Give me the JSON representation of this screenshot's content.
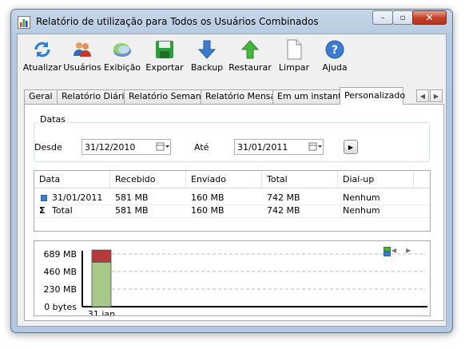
{
  "window": {
    "title": "Relatório de utilização para Todos os Usuários Combinados",
    "controls": {
      "minimize": "–",
      "maximize": "▫",
      "close": "✕"
    }
  },
  "toolbar": {
    "buttons": [
      {
        "label": "Atualizar",
        "icon": "refresh-icon"
      },
      {
        "label": "Usuários",
        "icon": "users-icon"
      },
      {
        "label": "Exibição",
        "icon": "view-icon"
      },
      {
        "label": "Exportar",
        "icon": "save-icon"
      },
      {
        "label": "Backup",
        "icon": "arrow-down-icon"
      },
      {
        "label": "Restaurar",
        "icon": "arrow-up-icon"
      },
      {
        "label": "Limpar",
        "icon": "document-icon"
      },
      {
        "label": "Ajuda",
        "icon": "help-icon"
      }
    ]
  },
  "tabs": [
    {
      "label": "Geral",
      "active": false
    },
    {
      "label": "Relatório Diário",
      "active": false
    },
    {
      "label": "Relatório Semanal",
      "active": false
    },
    {
      "label": "Relatório Mensal",
      "active": false
    },
    {
      "label": "Em um instante",
      "active": false
    },
    {
      "label": "Personalizado",
      "active": true
    }
  ],
  "dates": {
    "group_label": "Datas",
    "from_label": "Desde",
    "from_value": "31/12/2010",
    "to_label": "Até",
    "to_value": "31/01/2011"
  },
  "table": {
    "columns": [
      "Data",
      "Recebido",
      "Enviado",
      "Total",
      "Dial-up"
    ],
    "rows": [
      {
        "icon": "day-icon",
        "date": "31/01/2011",
        "received": "581 MB",
        "sent": "160 MB",
        "total": "742 MB",
        "dialup": "Nenhum"
      },
      {
        "icon": "sigma-icon",
        "date": "Total",
        "received": "581 MB",
        "sent": "160 MB",
        "total": "742 MB",
        "dialup": "Nenhum"
      }
    ]
  },
  "chart_data": {
    "type": "bar",
    "categories": [
      "31 jan"
    ],
    "y_tick_labels": [
      "0 bytes",
      "230 MB",
      "460 MB",
      "689 MB"
    ],
    "y_tick_values": [
      0,
      230,
      460,
      689
    ],
    "ylim": [
      0,
      689
    ],
    "series": [
      {
        "values": [
          581
        ],
        "color": "#a9c98a"
      },
      {
        "values": [
          160
        ],
        "color": "#b53a3a"
      }
    ],
    "grid": true
  },
  "colors": {
    "accent": "#3d7cc9",
    "received": "#a9c98a",
    "sent": "#b53a3a"
  }
}
